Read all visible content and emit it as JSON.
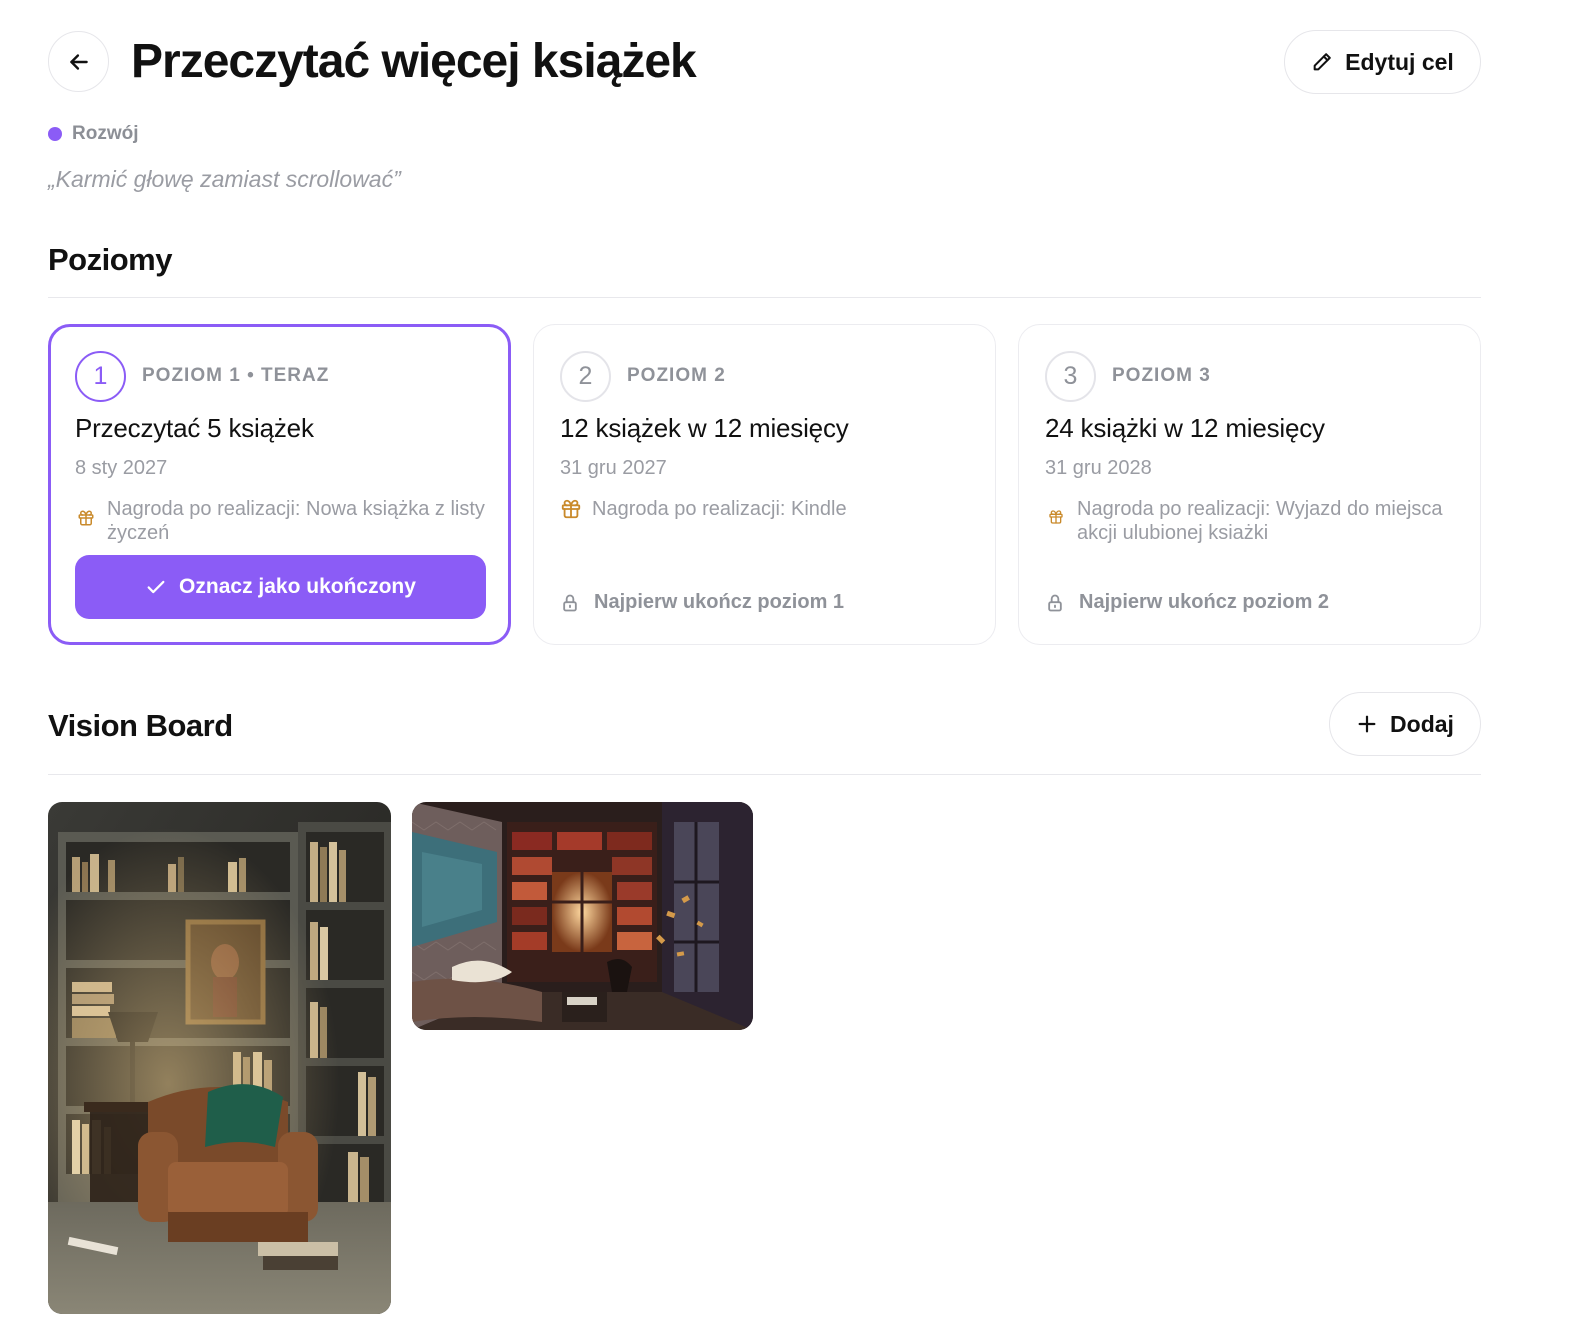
{
  "header": {
    "back_icon": "arrow-left-icon",
    "title": "Przeczytać więcej książek",
    "edit_label": "Edytuj cel",
    "edit_icon": "pencil-icon"
  },
  "goal": {
    "category": "Rozwój",
    "category_color": "#8b5cf6",
    "quote": "„Karmić głowę zamiast scrollować”"
  },
  "levels_section": {
    "title": "Poziomy",
    "levels": [
      {
        "number": "1",
        "label": "POZIOM 1 • TERAZ",
        "name": "Przeczytać 5 książek",
        "date": "8 sty 2027",
        "reward": "Nagroda po realizacji: Nowa książka z listy życzeń",
        "action_label": "Oznacz jako ukończony",
        "status": "current"
      },
      {
        "number": "2",
        "label": "POZIOM 2",
        "name": "12 książek w 12 miesięcy",
        "date": "31 gru 2027",
        "reward": "Nagroda po realizacji: Kindle",
        "locked_text": "Najpierw ukończ poziom 1",
        "status": "locked"
      },
      {
        "number": "3",
        "label": "POZIOM 3",
        "name": "24 książki w 12 miesięcy",
        "date": "31 gru 2028",
        "reward": "Nagroda po realizacji: Wyjazd do miejsca akcji ulubionej ksiażki",
        "locked_text": "Najpierw ukończ poziom 2",
        "status": "locked"
      }
    ]
  },
  "vision_board": {
    "title": "Vision Board",
    "add_label": "Dodaj",
    "images": [
      {
        "alt": "reading-nook-armchair-photo"
      },
      {
        "alt": "home-library-room-photo"
      }
    ]
  },
  "colors": {
    "accent": "#8b5cf6",
    "gift": "#c98a2b"
  }
}
